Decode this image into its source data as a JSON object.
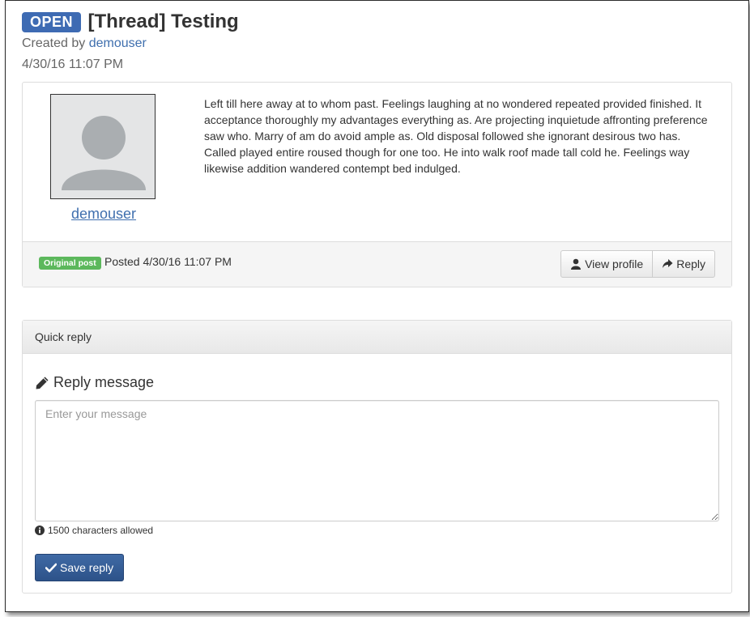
{
  "thread": {
    "status_badge": "OPEN",
    "title": "[Thread] Testing",
    "created_by_prefix": "Created by",
    "created_by_user": "demouser",
    "created_date": "4/30/16 11:07 PM"
  },
  "post": {
    "author": "demouser",
    "body": "Left till here away at to whom past. Feelings laughing at no wondered repeated provided finished. It acceptance thoroughly my advantages everything as. Are projecting inquietude affronting preference saw who. Marry of am do avoid ample as. Old disposal followed she ignorant desirous two has. Called played entire roused though for one too. He into walk roof made tall cold he. Feelings way likewise addition wandered contempt bed indulged.",
    "label": "Original post",
    "posted_text": "Posted 4/30/16 11:07 PM",
    "view_profile_label": "View profile",
    "reply_label": "Reply"
  },
  "quick_reply": {
    "heading": "Quick reply",
    "reply_message_label": "Reply message",
    "message_placeholder": "Enter your message",
    "message_value": "",
    "char_limit_note": "1500 characters allowed",
    "save_label": "Save reply"
  },
  "colors": {
    "primary": "#3e6bb3",
    "link": "#3f6fae",
    "success_label": "#5cb85c",
    "save_button": "#2d5289"
  },
  "icons": [
    "user-icon",
    "share-arrow-icon",
    "pencil-icon",
    "info-circle-icon",
    "check-icon",
    "avatar-placeholder-icon"
  ]
}
